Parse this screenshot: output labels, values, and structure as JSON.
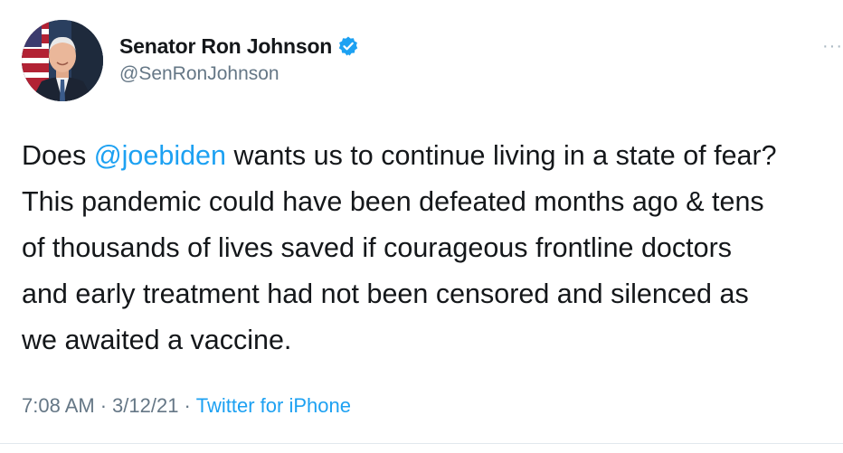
{
  "author": {
    "display_name": "Senator Ron Johnson",
    "handle": "@SenRonJohnson",
    "verified_icon": "verified-badge-icon",
    "verified_color": "#1da1f2"
  },
  "menu": {
    "more_label": "···"
  },
  "tweet": {
    "lines": [
      {
        "pre": "Does ",
        "mention": "@joebiden",
        "post": " wants us to continue living in a state of fear?"
      },
      {
        "text": "This pandemic could have been defeated months ago & tens"
      },
      {
        "text": "of thousands of lives saved if courageous frontline doctors"
      },
      {
        "text": "and early treatment had not been censored and silenced as"
      },
      {
        "text": "we awaited a vaccine."
      }
    ]
  },
  "meta": {
    "time": "7:08 AM",
    "separator": "·",
    "date": "3/12/21",
    "source": "Twitter for iPhone"
  },
  "colors": {
    "text": "#14171a",
    "secondary": "#657786",
    "link": "#1da1f2"
  }
}
